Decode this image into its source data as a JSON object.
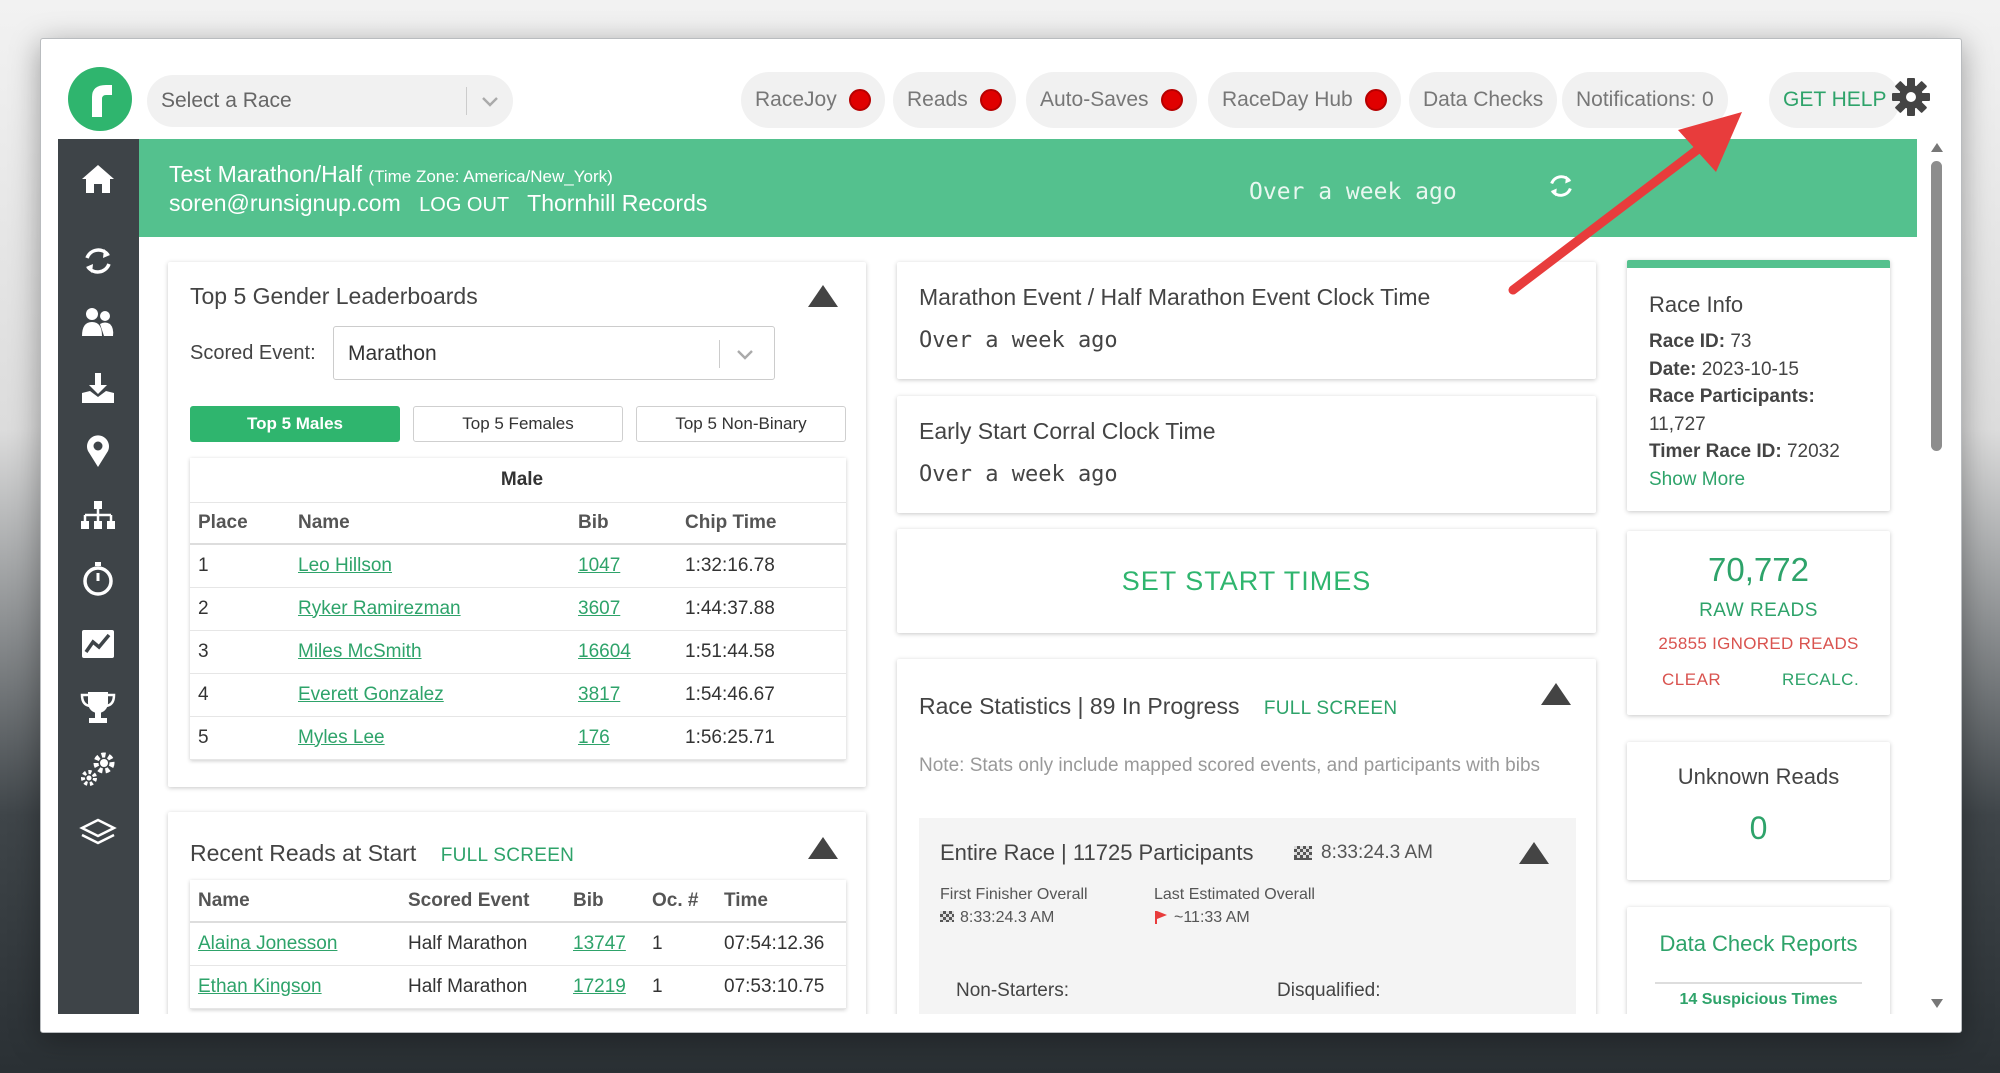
{
  "topbar": {
    "race_select_placeholder": "Select a Race",
    "pills": [
      {
        "label": "RaceJoy",
        "status": "red"
      },
      {
        "label": "Reads",
        "status": "red"
      },
      {
        "label": "Auto-Saves",
        "status": "red"
      },
      {
        "label": "RaceDay Hub",
        "status": "red"
      },
      {
        "label": "Data Checks"
      },
      {
        "label": "Notifications: 0"
      },
      {
        "label": "GET HELP"
      }
    ],
    "settings_icon": "gear-icon"
  },
  "sidebar": {
    "icons": [
      "home-icon",
      "sync-icon",
      "participants-icon",
      "download-icon",
      "location-pin-icon",
      "hierarchy-icon",
      "stopwatch-icon",
      "chart-icon",
      "trophy-icon",
      "settings-gears-icon",
      "layers-icon"
    ]
  },
  "banner": {
    "race_name": "Test Marathon/Half",
    "timezone": "(Time Zone: America/New_York)",
    "email": "soren@runsignup.com",
    "logout": "LOG OUT",
    "records": "Thornhill Records",
    "last_updated": "Over a week ago"
  },
  "leaderboards": {
    "title": "Top 5 Gender Leaderboards",
    "scored_event_label": "Scored Event:",
    "scored_event_value": "Marathon",
    "tabs": [
      "Top 5 Males",
      "Top 5 Females",
      "Top 5 Non-Binary"
    ],
    "table_caption": "Male",
    "columns": [
      "Place",
      "Name",
      "Bib",
      "Chip Time"
    ],
    "rows": [
      {
        "place": "1",
        "name": "Leo Hillson",
        "bib": "1047",
        "time": "1:32:16.78"
      },
      {
        "place": "2",
        "name": "Ryker Ramirezman",
        "bib": "3607",
        "time": "1:44:37.88"
      },
      {
        "place": "3",
        "name": "Miles McSmith",
        "bib": "16604",
        "time": "1:51:44.58"
      },
      {
        "place": "4",
        "name": "Everett Gonzalez",
        "bib": "3817",
        "time": "1:54:46.67"
      },
      {
        "place": "5",
        "name": "Myles Lee",
        "bib": "176",
        "time": "1:56:25.71"
      }
    ]
  },
  "recent_reads": {
    "title": "Recent Reads at Start",
    "fullscreen": "FULL SCREEN",
    "columns": [
      "Name",
      "Scored Event",
      "Bib",
      "Oc. #",
      "Time"
    ],
    "rows": [
      {
        "name": "Alaina Jonesson",
        "event": "Half Marathon",
        "bib": "13747",
        "oc": "1",
        "time": "07:54:12.36"
      },
      {
        "name": "Ethan Kingson",
        "event": "Half Marathon",
        "bib": "17219",
        "oc": "1",
        "time": "07:53:10.75"
      }
    ]
  },
  "clock_times": [
    {
      "title": "Marathon Event / Half Marathon Event Clock Time",
      "value": "Over a week ago"
    },
    {
      "title": "Early Start Corral Clock Time",
      "value": "Over a week ago"
    }
  ],
  "set_start_times": "SET START TIMES",
  "race_stats": {
    "title": "Race Statistics | 89 In Progress",
    "fullscreen": "FULL SCREEN",
    "note": "Note: Stats only include mapped scored events, and participants with bibs",
    "entire_race": "Entire Race | 11725 Participants",
    "entire_time": "8:33:24.3 AM",
    "first_finisher_label": "First Finisher Overall",
    "first_finisher_value": "8:33:24.3 AM",
    "last_est_label": "Last Estimated Overall",
    "last_est_value": "~11:33 AM",
    "non_starters": "Non-Starters:",
    "disqualified": "Disqualified:"
  },
  "race_info": {
    "title": "Race Info",
    "race_id_label": "Race ID:",
    "race_id": "73",
    "date_label": "Date:",
    "date": "2023-10-15",
    "participants_label": "Race Participants:",
    "participants": "11,727",
    "timer_id_label": "Timer Race ID:",
    "timer_id": "72032",
    "show_more": "Show More"
  },
  "reads": {
    "raw_count": "70,772",
    "raw_label": "RAW READS",
    "ignored": "25855 IGNORED READS",
    "clear": "CLEAR",
    "recalc": "RECALC."
  },
  "unknown_reads": {
    "title": "Unknown Reads",
    "count": "0"
  },
  "data_check": {
    "title": "Data Check Reports",
    "item": "14 Suspicious Times"
  },
  "colors": {
    "accent": "#2fb56e",
    "banner": "#54c18e",
    "sidebar": "#3e4448",
    "alert": "#e00000",
    "annotation_arrow": "#e83c3c"
  }
}
